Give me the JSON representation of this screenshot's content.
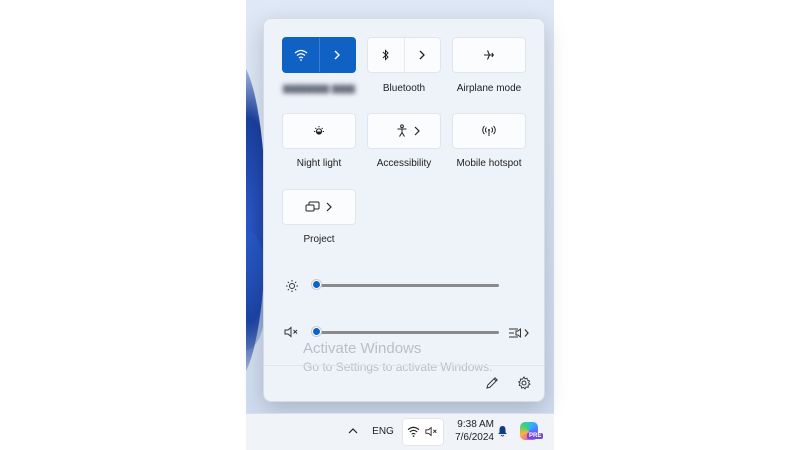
{
  "tiles": {
    "wifi": {
      "label": "",
      "icon": "wifi-icon",
      "state": "on"
    },
    "bluetooth": {
      "label": "Bluetooth",
      "icon": "bluetooth-icon"
    },
    "airplane": {
      "label": "Airplane mode",
      "icon": "airplane-icon"
    },
    "night_light": {
      "label": "Night light",
      "icon": "night-light-icon"
    },
    "accessibility": {
      "label": "Accessibility",
      "icon": "accessibility-icon"
    },
    "mobile_hotspot": {
      "label": "Mobile hotspot",
      "icon": "hotspot-icon"
    },
    "project": {
      "label": "Project",
      "icon": "project-icon"
    }
  },
  "sliders": {
    "brightness": {
      "icon": "brightness-icon",
      "level": 0
    },
    "volume": {
      "icon": "volume-muted-icon",
      "level": 0
    }
  },
  "watermark": {
    "title": "Activate Windows",
    "subtitle": "Go to Settings to activate Windows."
  },
  "taskbar": {
    "language": "ENG",
    "time": "9:38 AM",
    "date": "7/6/2024",
    "copilot_badge": "PRE"
  },
  "colors": {
    "accent": "#0f62c4"
  }
}
